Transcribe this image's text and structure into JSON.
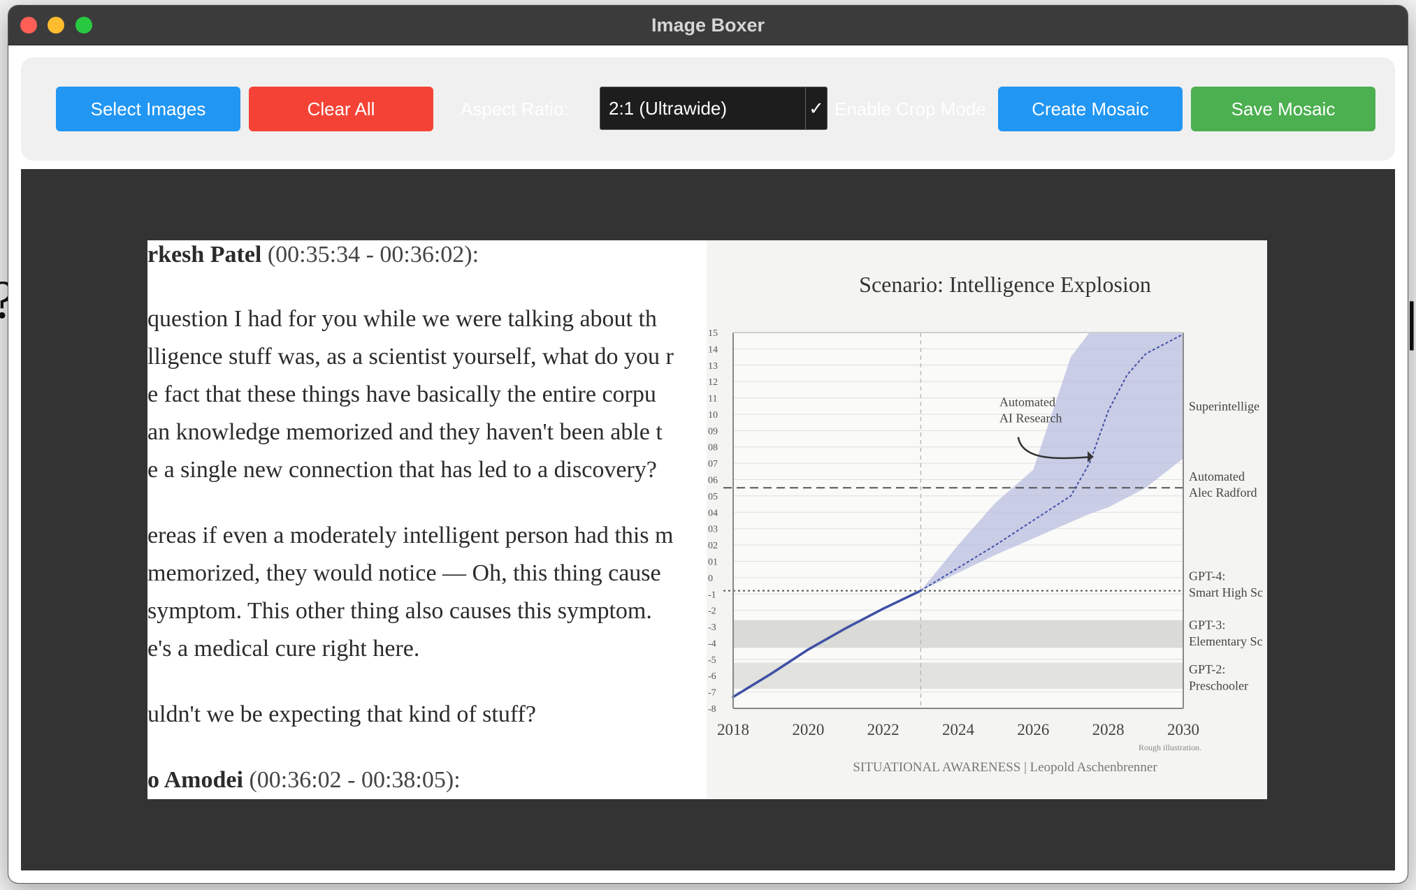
{
  "window": {
    "title": "Image Boxer"
  },
  "toolbar": {
    "select_images": "Select Images",
    "clear_all": "Clear All",
    "aspect_ratio_label": "Aspect Ratio:",
    "aspect_ratio_value": "2:1 (Ultrawide)",
    "dropdown_check": "✓",
    "crop_mode_label": "Enable Crop Mode",
    "create_mosaic": "Create Mosaic",
    "save_mosaic": "Save Mosaic"
  },
  "colors": {
    "titlebar": "#3b3b3b",
    "primary_button": "#2196f3",
    "danger_button": "#f44336",
    "success_button": "#4caf50",
    "canvas_background": "#333333"
  },
  "transcript": {
    "speaker1_name": "rkesh Patel",
    "speaker1_time": "(00:35:34 - 00:36:02):",
    "para1": [
      "question I had for you while we were talking about th",
      "lligence stuff was, as a scientist yourself, what do you r",
      "e fact that these things have basically the entire corpu",
      "an knowledge memorized and they haven't been able t",
      "e a single new connection that has led to a discovery?"
    ],
    "para2": [
      "ereas if even a moderately intelligent person had this m",
      "memorized, they would notice — Oh, this thing cause",
      "symptom. This other thing also causes this symptom.",
      "e's a medical cure right here."
    ],
    "para3": "uldn't we be expecting that kind of stuff?",
    "speaker2_name": "o Amodei",
    "speaker2_time": "(00:36:02 - 00:38:05):"
  },
  "chart_data": {
    "type": "line",
    "title": "Scenario: Intelligence Explosion",
    "x_ticks": [
      "2018",
      "2020",
      "2022",
      "2024",
      "2026",
      "2028",
      "2030"
    ],
    "xlim": [
      2018,
      2030
    ],
    "y_ticks": [
      "15",
      "14",
      "13",
      "12",
      "11",
      "10",
      "09",
      "08",
      "07",
      "06",
      "05",
      "04",
      "03",
      "02",
      "01",
      "0",
      "-1",
      "-2",
      "-3",
      "-4",
      "-5",
      "-6",
      "-7",
      "-8"
    ],
    "ylim": [
      -8,
      15
    ],
    "series": [
      {
        "x": [
          2018,
          2019,
          2020,
          2021,
          2022,
          2023
        ],
        "y": [
          -7.3,
          -5.9,
          -4.4,
          -3.1,
          -1.9,
          -0.8
        ]
      }
    ],
    "projection": {
      "x": [
        2023,
        2024,
        2025,
        2026,
        2027,
        2027.5,
        2028,
        2028.5,
        2029,
        2030
      ],
      "y": [
        -0.8,
        0.6,
        2.0,
        3.5,
        5.0,
        7.0,
        10.2,
        12.4,
        13.7,
        14.9
      ],
      "upper": [
        -0.8,
        2.0,
        4.6,
        6.6,
        13.5,
        15,
        15,
        15,
        15,
        15
      ],
      "lower": [
        -0.8,
        0.3,
        1.4,
        2.4,
        3.4,
        3.9,
        4.3,
        4.9,
        5.5,
        7.3
      ]
    },
    "reference_lines": [
      {
        "y": 5.5,
        "style": "dashed"
      },
      {
        "y": -0.8,
        "style": "dotted"
      }
    ],
    "annotations": [
      {
        "text": "Automated",
        "x": 2025.1,
        "y": 10.5
      },
      {
        "text": "AI Research",
        "x": 2025.1,
        "y": 9.5
      }
    ],
    "right_labels": [
      {
        "text": "Superintellige",
        "y": 10.5
      },
      {
        "text": "Automated",
        "y": 6.2
      },
      {
        "text": "Alec Radford",
        "y": 5.2
      },
      {
        "text": "GPT-4:",
        "y": 0.1
      },
      {
        "text": "Smart High Sc",
        "y": -0.9
      },
      {
        "text": "GPT-3:",
        "y": -2.9
      },
      {
        "text": "Elementary Sc",
        "y": -3.9
      },
      {
        "text": "GPT-2:",
        "y": -5.6
      },
      {
        "text": "Preschooler",
        "y": -6.6
      }
    ],
    "footnote": "Rough illustration.",
    "source": "SITUATIONAL AWARENESS | Leopold Aschenbrenner",
    "grid": true,
    "colors": {
      "line": "#3f51a5",
      "band": "#b9bde0",
      "axis": "#888888"
    }
  }
}
